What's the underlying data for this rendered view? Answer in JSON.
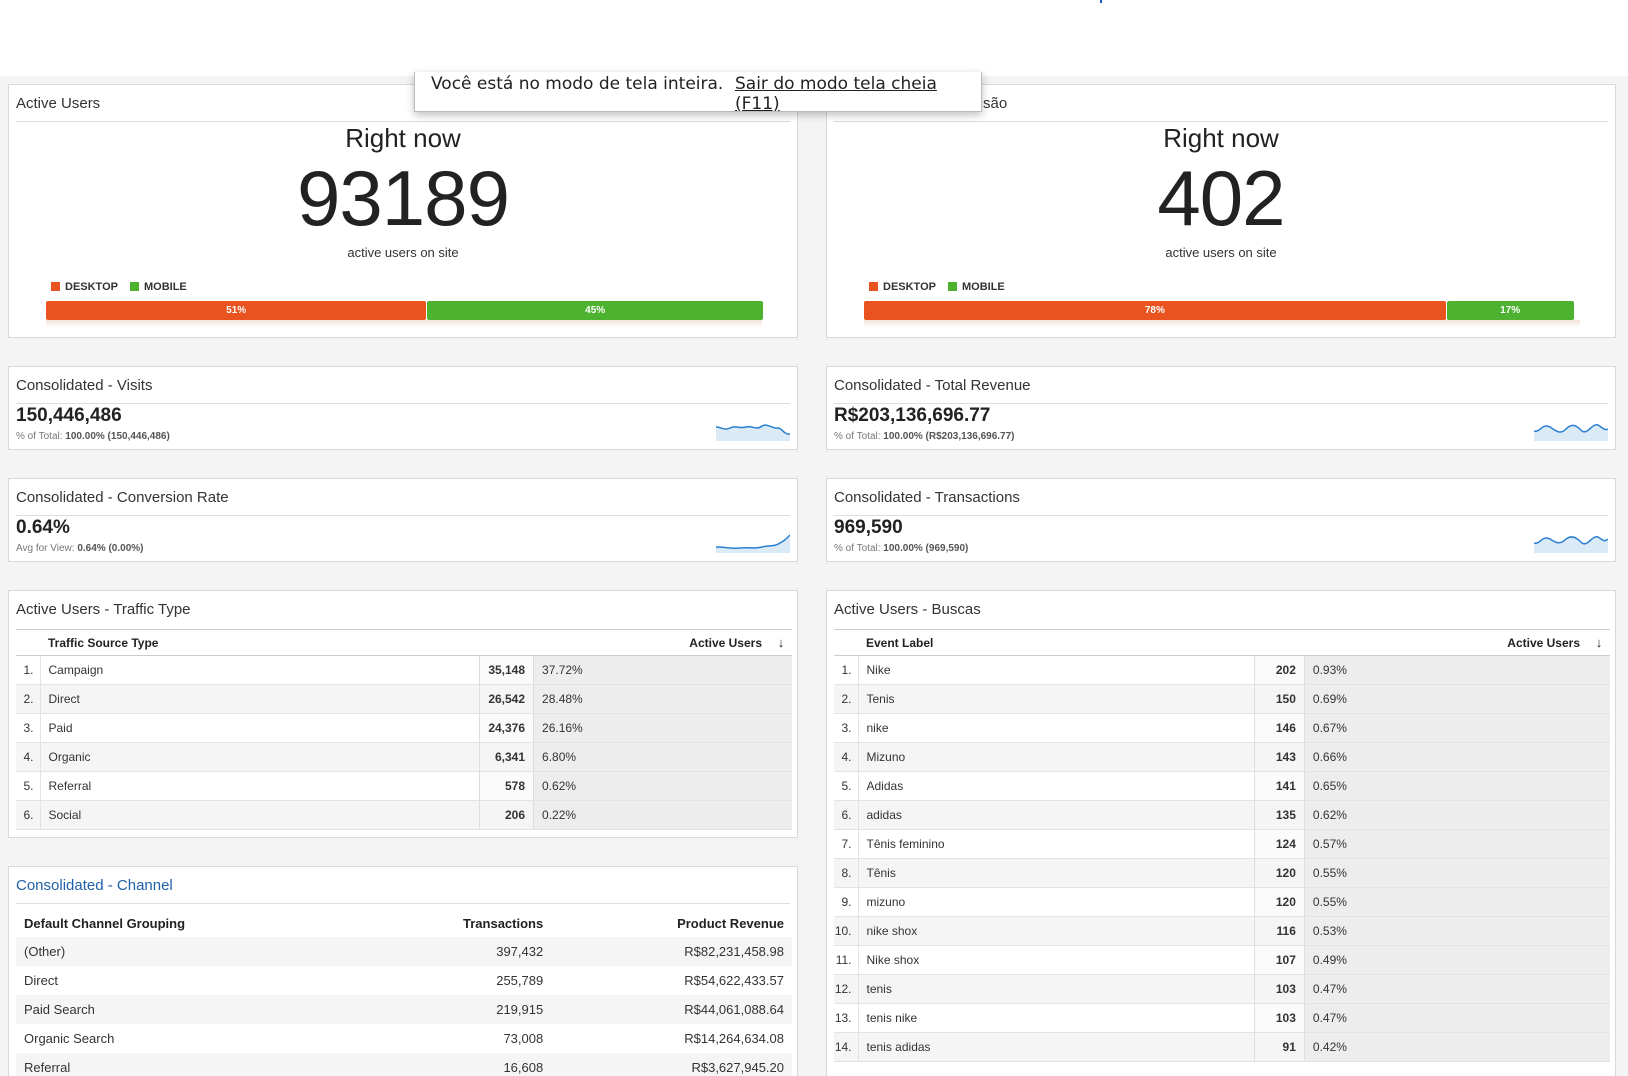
{
  "fullscreen_notice": {
    "message": "Você está no modo de tela inteira.",
    "exit_link": "Sair do modo tela cheia (F11)"
  },
  "realtime_left": {
    "title": "Active Users",
    "heading": "Right now",
    "count": "93189",
    "caption": "active users on site",
    "legend_desktop": "DESKTOP",
    "legend_mobile": "MOBILE",
    "desktop_pct": "51%",
    "mobile_pct": "45%",
    "desktop_share": 0.51,
    "mobile_share": 0.45
  },
  "realtime_right": {
    "title_visible_fragment": "são",
    "heading": "Right now",
    "count": "402",
    "caption": "active users on site",
    "legend_desktop": "DESKTOP",
    "legend_mobile": "MOBILE",
    "desktop_pct": "78%",
    "mobile_pct": "17%",
    "desktop_share": 0.78,
    "mobile_share": 0.17
  },
  "colors": {
    "desktop": "#e8531f",
    "mobile": "#4cb22f",
    "link": "#2160a8",
    "sparkline": "#2a7fd0"
  },
  "metrics": {
    "visits": {
      "title": "Consolidated - Visits",
      "value": "150,446,486",
      "sub_label": "% of Total:",
      "sub_value": "100.00% (150,446,486)"
    },
    "revenue": {
      "title": "Consolidated - Total Revenue",
      "value": "R$203,136,696.77",
      "sub_label": "% of Total:",
      "sub_value": "100.00% (R$203,136,696.77)"
    },
    "conversion": {
      "title": "Consolidated - Conversion Rate",
      "value": "0.64%",
      "sub_label": "Avg for View:",
      "sub_value": "0.64% (0.00%)"
    },
    "transactions": {
      "title": "Consolidated - Transactions",
      "value": "969,590",
      "sub_label": "% of Total:",
      "sub_value": "100.00% (969,590)"
    }
  },
  "traffic_type": {
    "title": "Active Users - Traffic Type",
    "col_dimension": "Traffic Source Type",
    "col_metric": "Active Users",
    "sort_icon": "arrow-down-icon",
    "rows": [
      {
        "idx": "1.",
        "label": "Campaign",
        "value": "35,148",
        "pct": "37.72%"
      },
      {
        "idx": "2.",
        "label": "Direct",
        "value": "26,542",
        "pct": "28.48%"
      },
      {
        "idx": "3.",
        "label": "Paid",
        "value": "24,376",
        "pct": "26.16%"
      },
      {
        "idx": "4.",
        "label": "Organic",
        "value": "6,341",
        "pct": "6.80%"
      },
      {
        "idx": "5.",
        "label": "Referral",
        "value": "578",
        "pct": "0.62%"
      },
      {
        "idx": "6.",
        "label": "Social",
        "value": "206",
        "pct": "0.22%"
      }
    ]
  },
  "buscas": {
    "title": "Active Users - Buscas",
    "col_dimension": "Event Label",
    "col_metric": "Active Users",
    "sort_icon": "arrow-down-icon",
    "rows": [
      {
        "idx": "1.",
        "label": "Nike",
        "value": "202",
        "pct": "0.93%"
      },
      {
        "idx": "2.",
        "label": "Tenis",
        "value": "150",
        "pct": "0.69%"
      },
      {
        "idx": "3.",
        "label": "nike",
        "value": "146",
        "pct": "0.67%"
      },
      {
        "idx": "4.",
        "label": "Mizuno",
        "value": "143",
        "pct": "0.66%"
      },
      {
        "idx": "5.",
        "label": "Adidas",
        "value": "141",
        "pct": "0.65%"
      },
      {
        "idx": "6.",
        "label": "adidas",
        "value": "135",
        "pct": "0.62%"
      },
      {
        "idx": "7.",
        "label": "Tênis feminino",
        "value": "124",
        "pct": "0.57%"
      },
      {
        "idx": "8.",
        "label": "Tênis",
        "value": "120",
        "pct": "0.55%"
      },
      {
        "idx": "9.",
        "label": "mizuno",
        "value": "120",
        "pct": "0.55%"
      },
      {
        "idx": "10.",
        "label": "nike shox",
        "value": "116",
        "pct": "0.53%"
      },
      {
        "idx": "11.",
        "label": "Nike shox",
        "value": "107",
        "pct": "0.49%"
      },
      {
        "idx": "12.",
        "label": "tenis",
        "value": "103",
        "pct": "0.47%"
      },
      {
        "idx": "13.",
        "label": "tenis nike",
        "value": "103",
        "pct": "0.47%"
      },
      {
        "idx": "14.",
        "label": "tenis adidas",
        "value": "91",
        "pct": "0.42%"
      }
    ]
  },
  "channel": {
    "title": "Consolidated - Channel",
    "col_dimension": "Default Channel Grouping",
    "col_transactions": "Transactions",
    "col_revenue": "Product Revenue",
    "rows": [
      {
        "label": "(Other)",
        "transactions": "397,432",
        "revenue": "R$82,231,458.98"
      },
      {
        "label": "Direct",
        "transactions": "255,789",
        "revenue": "R$54,622,433.57"
      },
      {
        "label": "Paid Search",
        "transactions": "219,915",
        "revenue": "R$44,061,088.64"
      },
      {
        "label": "Organic Search",
        "transactions": "73,008",
        "revenue": "R$14,264,634.08"
      },
      {
        "label": "Referral",
        "transactions": "16,608",
        "revenue": "R$3,627,945.20"
      }
    ]
  }
}
